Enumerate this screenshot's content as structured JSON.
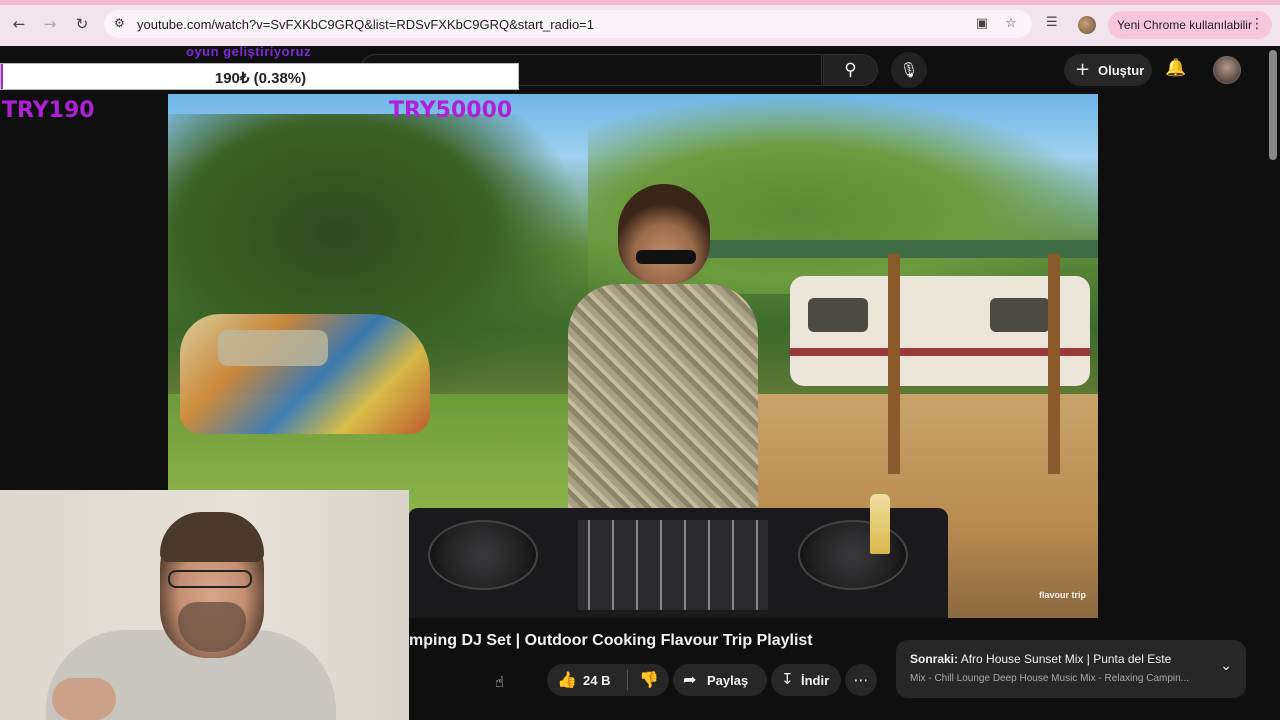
{
  "browser": {
    "url": "youtube.com/watch?v=SvFXKbC9GRQ&list=RDSvFXKbC9GRQ&start_radio=1",
    "promo_pill": "Yeni Chrome kullanılabilir"
  },
  "youtube_header": {
    "create_label": "Oluştur"
  },
  "stream_overlay": {
    "tag": "oyun geliştiriyoruz",
    "donation_text": "190₺ (0.38%)",
    "donation_progress": 0.0038,
    "goal_left": "TRY190",
    "goal_right": "TRY50000",
    "accent_color": "#b020d6"
  },
  "video": {
    "watermark": "flavour trip",
    "title": "mping DJ Set | Outdoor Cooking Flavour Trip Playlist"
  },
  "actions": {
    "like_count": "24 B",
    "share_label": "Paylaş",
    "download_label": "İndir"
  },
  "next_card": {
    "prefix": "Sonraki:",
    "title": "Afro House Sunset Mix | Punta del Este",
    "subtitle": "Mix - Chill Lounge Deep House Music Mix - Relaxing Campin..."
  },
  "icons": [
    "back-icon",
    "forward-icon",
    "reload-icon",
    "site-info-icon",
    "install-icon",
    "star-icon",
    "media-icon",
    "search-icon",
    "mic-icon",
    "plus-icon",
    "bell-icon",
    "like-icon",
    "dislike-icon",
    "share-icon",
    "download-icon",
    "more-icon",
    "chevron-down-icon"
  ]
}
